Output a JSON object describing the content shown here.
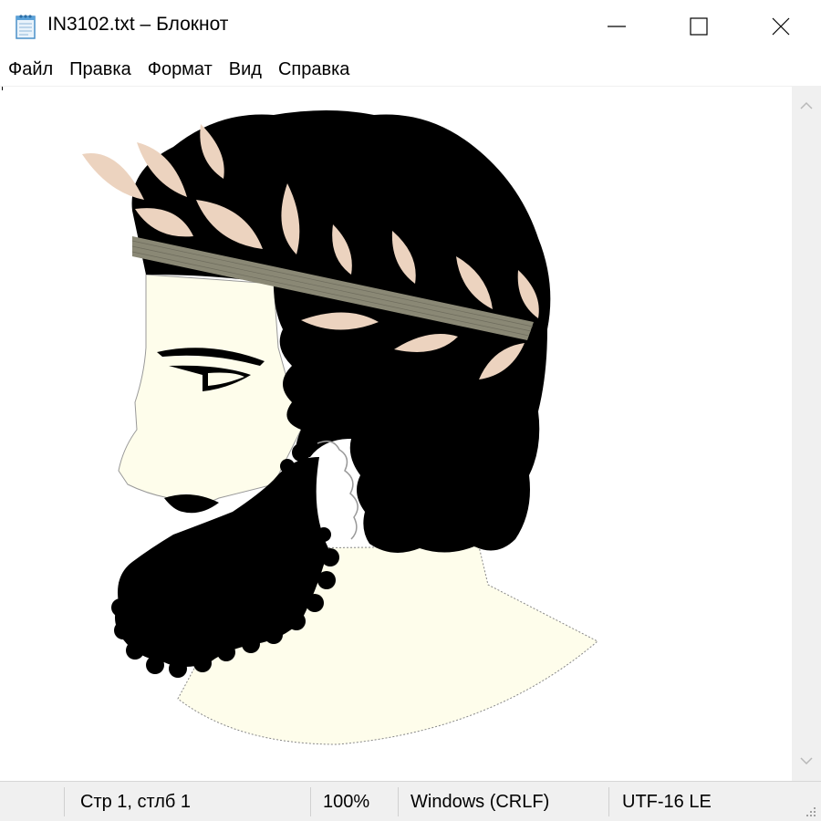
{
  "window": {
    "title": "IN3102.txt – Блокнот",
    "app_icon": "notepad-icon",
    "controls": {
      "minimize_icon": "minimize-icon",
      "maximize_icon": "maximize-icon",
      "close_icon": "close-icon"
    }
  },
  "menu": {
    "items": [
      {
        "label": "Файл"
      },
      {
        "label": "Правка"
      },
      {
        "label": "Формат"
      },
      {
        "label": "Вид"
      },
      {
        "label": "Справка"
      }
    ]
  },
  "document": {
    "content_image": "laurel-crowned-bearded-man-profile",
    "colors": {
      "hair": "#000000",
      "skin": "#fefdeb",
      "leaves": "#ecd3bf",
      "band": "#8a8875"
    }
  },
  "scrollbar": {
    "up_icon": "chevron-up-icon",
    "down_icon": "chevron-down-icon"
  },
  "status": {
    "position": "Стр 1, стлб 1",
    "zoom": "100%",
    "line_endings": "Windows (CRLF)",
    "encoding": "UTF-16 LE"
  }
}
